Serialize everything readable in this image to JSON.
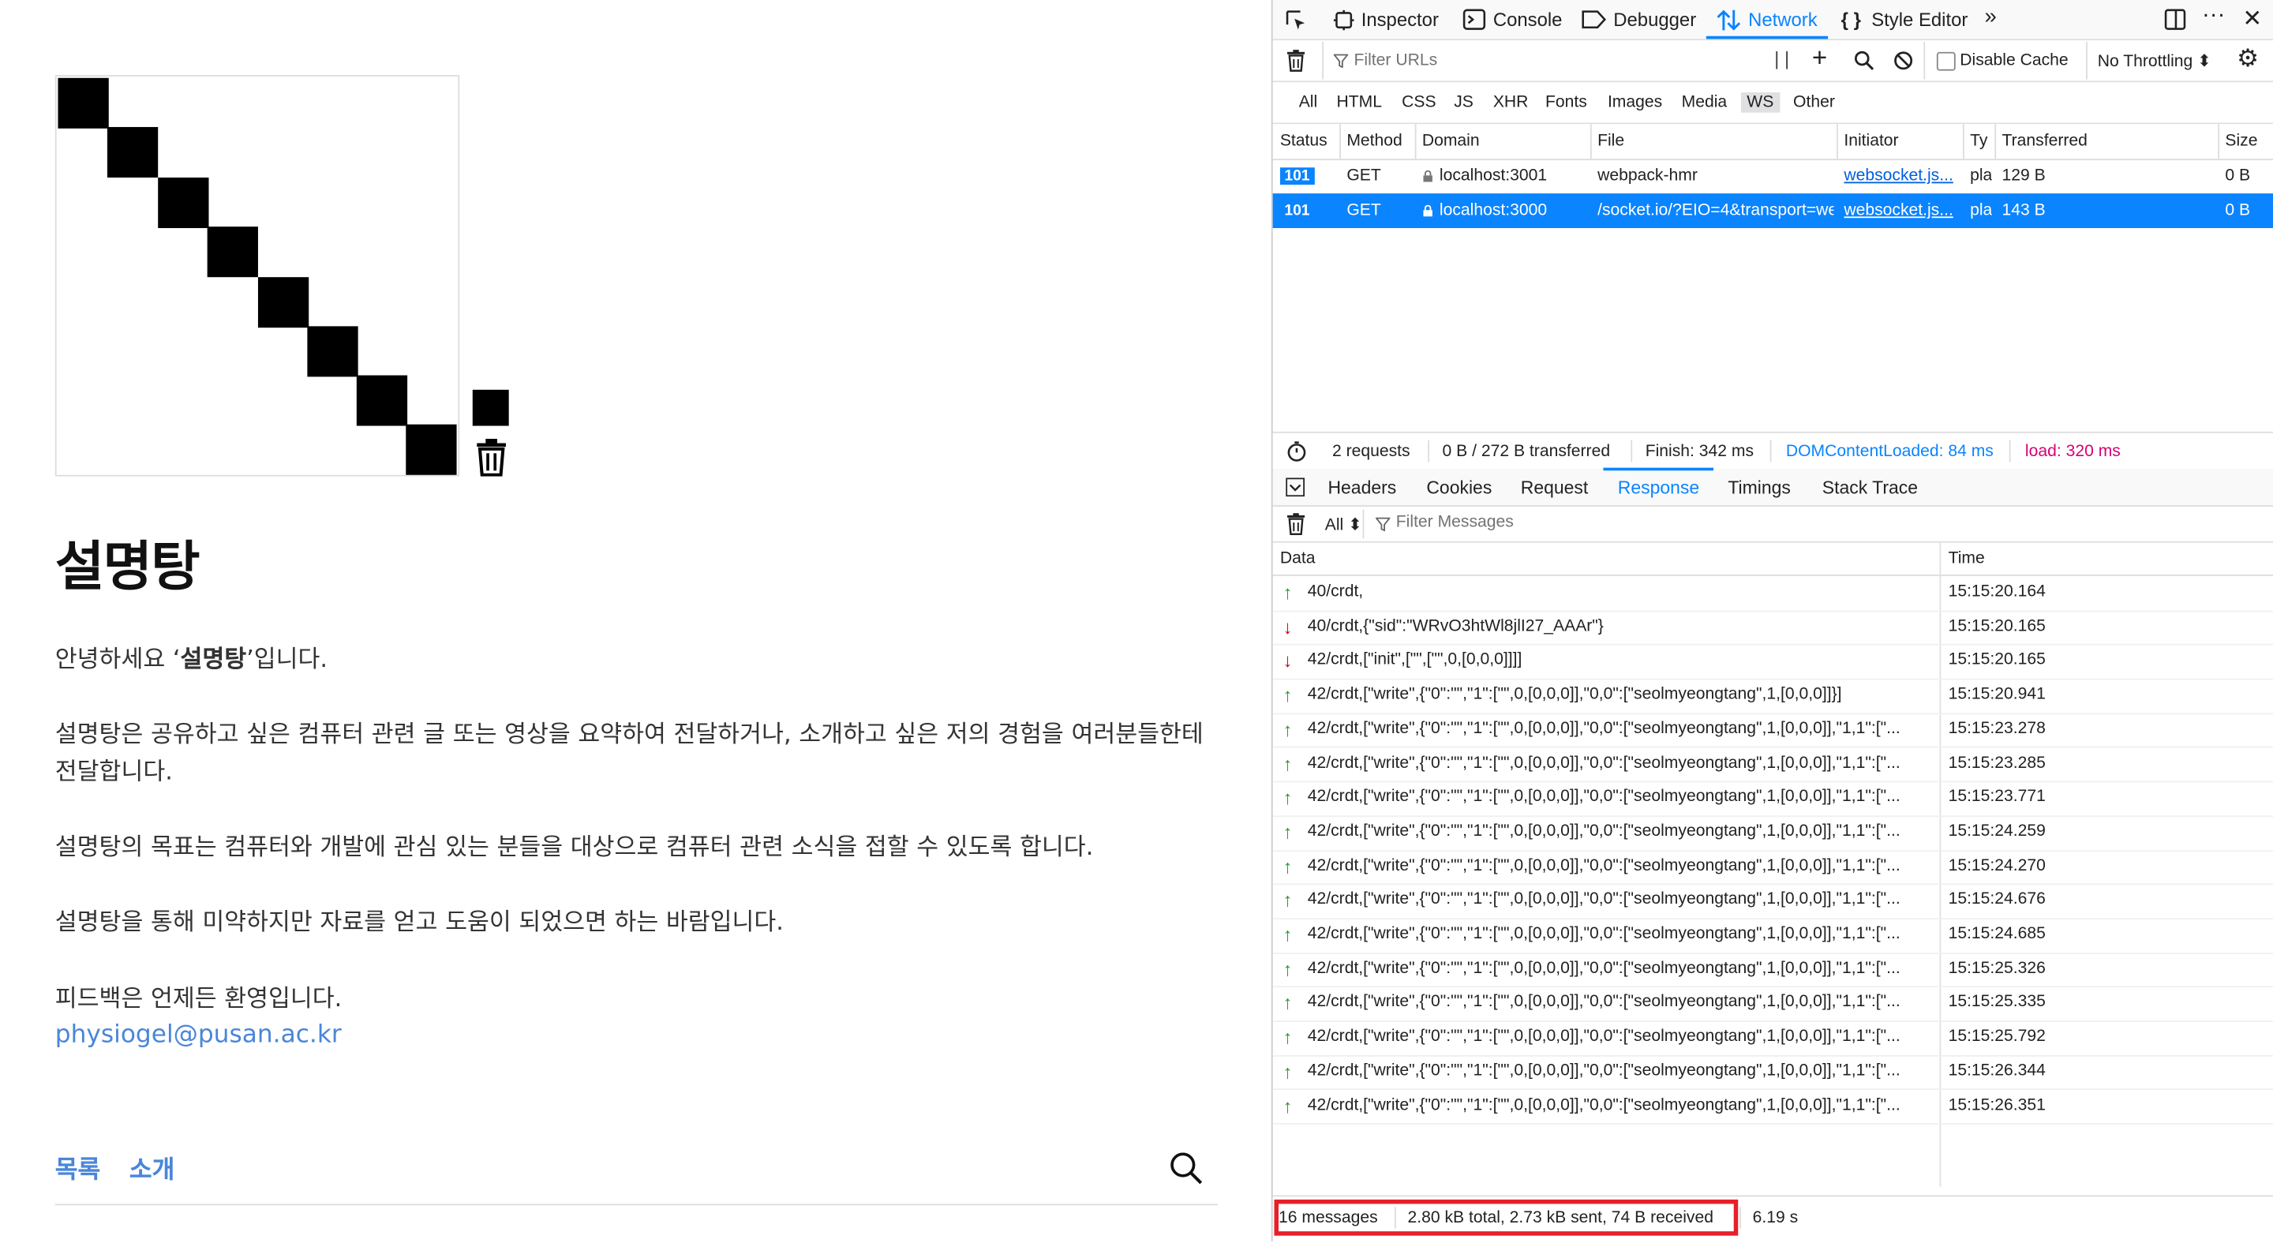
{
  "page": {
    "title": "설명탕",
    "intro_prefix": "안녕하세요 ‘",
    "intro_bold": "설명탕",
    "intro_suffix": "’입니다.",
    "paragraph_1": "설명탕은 공유하고 싶은 컴퓨터 관련 글 또는 영상을 요약하여 전달하거나, 소개하고 싶은 저의 경험을 여러분들한테 전달합니다.",
    "paragraph_2": "설명탕의 목표는 컴퓨터와 개발에 관심 있는 분들을 대상으로 컴퓨터 관련 소식을 접할 수 있도록 합니다.",
    "paragraph_3": "설명탕을 통해 미약하지만 자료를 얻고 도움이 되었으면 하는 바람입니다.",
    "paragraph_4": "피드백은 언제든 환영입니다.",
    "email": "physiogel@pusan.ac.kr",
    "nav_list": "목록",
    "nav_about": "소개"
  },
  "devtools": {
    "tabs": [
      "Inspector",
      "Console",
      "Debugger",
      "Network",
      "Style Editor"
    ],
    "filter_placeholder": "Filter URLs",
    "disable_cache": "Disable Cache",
    "throttling": "No Throttling ⬍",
    "types": [
      "All",
      "HTML",
      "CSS",
      "JS",
      "XHR",
      "Fonts",
      "Images",
      "Media",
      "WS",
      "Other"
    ],
    "columns": [
      "Status",
      "Method",
      "Domain",
      "File",
      "Initiator",
      "Ty",
      "Transferred",
      "Size"
    ],
    "requests": [
      {
        "status": "101",
        "method": "GET",
        "domain": "localhost:3001",
        "file": "webpack-hmr",
        "initiator": "websocket.js...",
        "type": "pla",
        "transferred": "129 B",
        "size": "0 B"
      },
      {
        "status": "101",
        "method": "GET",
        "domain": "localhost:3000",
        "file": "/socket.io/?EIO=4&transport=we",
        "initiator": "websocket.js...",
        "type": "pla",
        "transferred": "143 B",
        "size": "0 B"
      }
    ],
    "summary": {
      "requests": "2 requests",
      "transferred": "0 B / 272 B transferred",
      "finish": "Finish: 342 ms",
      "dom": "DOMContentLoaded: 84 ms",
      "load": "load: 320 ms"
    },
    "detail_tabs": [
      "Headers",
      "Cookies",
      "Request",
      "Response",
      "Timings",
      "Stack Trace"
    ],
    "msg_filter_select": "All ⬍",
    "msg_filter_placeholder": "Filter Messages",
    "msg_columns": [
      "Data",
      "Time"
    ],
    "messages": [
      {
        "dir": "up",
        "data": "40/crdt,",
        "time": "15:15:20.164"
      },
      {
        "dir": "down",
        "data": "40/crdt,{\"sid\":\"WRvO3htWl8jlI27_AAAr\"}",
        "time": "15:15:20.165"
      },
      {
        "dir": "down",
        "data": "42/crdt,[\"init\",[\"\",[\"\",0,[0,0,0]]]]",
        "time": "15:15:20.165"
      },
      {
        "dir": "up",
        "data": "42/crdt,[\"write\",{\"0\":\"\",\"1\":[\"\",0,[0,0,0]],\"0,0\":[\"seolmyeongtang\",1,[0,0,0]]}]",
        "time": "15:15:20.941"
      },
      {
        "dir": "up",
        "data": "42/crdt,[\"write\",{\"0\":\"\",\"1\":[\"\",0,[0,0,0]],\"0,0\":[\"seolmyeongtang\",1,[0,0,0]],\"1,1\":[\"...",
        "time": "15:15:23.278"
      },
      {
        "dir": "up",
        "data": "42/crdt,[\"write\",{\"0\":\"\",\"1\":[\"\",0,[0,0,0]],\"0,0\":[\"seolmyeongtang\",1,[0,0,0]],\"1,1\":[\"...",
        "time": "15:15:23.285"
      },
      {
        "dir": "up",
        "data": "42/crdt,[\"write\",{\"0\":\"\",\"1\":[\"\",0,[0,0,0]],\"0,0\":[\"seolmyeongtang\",1,[0,0,0]],\"1,1\":[\"...",
        "time": "15:15:23.771"
      },
      {
        "dir": "up",
        "data": "42/crdt,[\"write\",{\"0\":\"\",\"1\":[\"\",0,[0,0,0]],\"0,0\":[\"seolmyeongtang\",1,[0,0,0]],\"1,1\":[\"...",
        "time": "15:15:24.259"
      },
      {
        "dir": "up",
        "data": "42/crdt,[\"write\",{\"0\":\"\",\"1\":[\"\",0,[0,0,0]],\"0,0\":[\"seolmyeongtang\",1,[0,0,0]],\"1,1\":[\"...",
        "time": "15:15:24.270"
      },
      {
        "dir": "up",
        "data": "42/crdt,[\"write\",{\"0\":\"\",\"1\":[\"\",0,[0,0,0]],\"0,0\":[\"seolmyeongtang\",1,[0,0,0]],\"1,1\":[\"...",
        "time": "15:15:24.676"
      },
      {
        "dir": "up",
        "data": "42/crdt,[\"write\",{\"0\":\"\",\"1\":[\"\",0,[0,0,0]],\"0,0\":[\"seolmyeongtang\",1,[0,0,0]],\"1,1\":[\"...",
        "time": "15:15:24.685"
      },
      {
        "dir": "up",
        "data": "42/crdt,[\"write\",{\"0\":\"\",\"1\":[\"\",0,[0,0,0]],\"0,0\":[\"seolmyeongtang\",1,[0,0,0]],\"1,1\":[\"...",
        "time": "15:15:25.326"
      },
      {
        "dir": "up",
        "data": "42/crdt,[\"write\",{\"0\":\"\",\"1\":[\"\",0,[0,0,0]],\"0,0\":[\"seolmyeongtang\",1,[0,0,0]],\"1,1\":[\"...",
        "time": "15:15:25.335"
      },
      {
        "dir": "up",
        "data": "42/crdt,[\"write\",{\"0\":\"\",\"1\":[\"\",0,[0,0,0]],\"0,0\":[\"seolmyeongtang\",1,[0,0,0]],\"1,1\":[\"...",
        "time": "15:15:25.792"
      },
      {
        "dir": "up",
        "data": "42/crdt,[\"write\",{\"0\":\"\",\"1\":[\"\",0,[0,0,0]],\"0,0\":[\"seolmyeongtang\",1,[0,0,0]],\"1,1\":[\"...",
        "time": "15:15:26.344"
      },
      {
        "dir": "up",
        "data": "42/crdt,[\"write\",{\"0\":\"\",\"1\":[\"\",0,[0,0,0]],\"0,0\":[\"seolmyeongtang\",1,[0,0,0]],\"1,1\":[\"...",
        "time": "15:15:26.351"
      }
    ],
    "footer": {
      "count": "16 messages",
      "totals": "2.80 kB total, 2.73 kB sent, 74 B received",
      "duration": "6.19 s"
    },
    "colors": {
      "accent": "#0a84ff",
      "highlight": "#e6202a",
      "up": "#2d9a2d",
      "down": "#d70022"
    }
  }
}
